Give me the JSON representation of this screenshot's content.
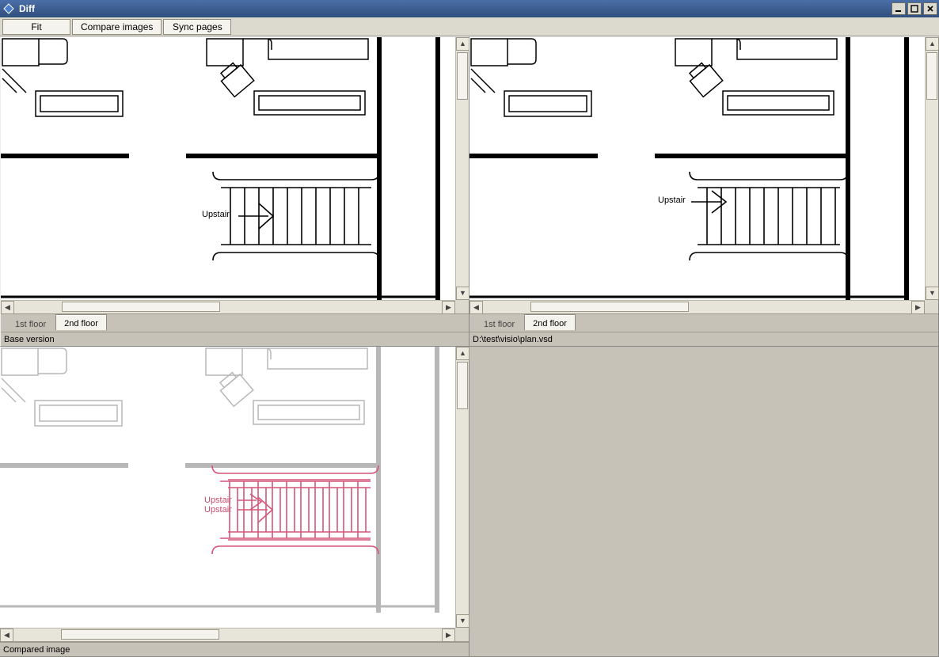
{
  "window": {
    "title": "Diff",
    "min_tooltip": "Minimize",
    "max_tooltip": "Maximize",
    "close_tooltip": "Close"
  },
  "toolbar": {
    "fit": "Fit",
    "compare": "Compare images",
    "sync": "Sync pages"
  },
  "pane_tl": {
    "tabs": [
      "1st floor",
      "2nd floor"
    ],
    "active_tab_index": 0,
    "status": "Base version",
    "stair_label": "Upstair"
  },
  "pane_tr": {
    "tabs": [
      "1st floor",
      "2nd floor"
    ],
    "active_tab_index": 0,
    "status": "D:\\test\\visio\\plan.vsd",
    "stair_label": "Upstair"
  },
  "pane_bl": {
    "status": "Compared image",
    "stair_label_1": "Upstair",
    "stair_label_2": "Upstair"
  }
}
